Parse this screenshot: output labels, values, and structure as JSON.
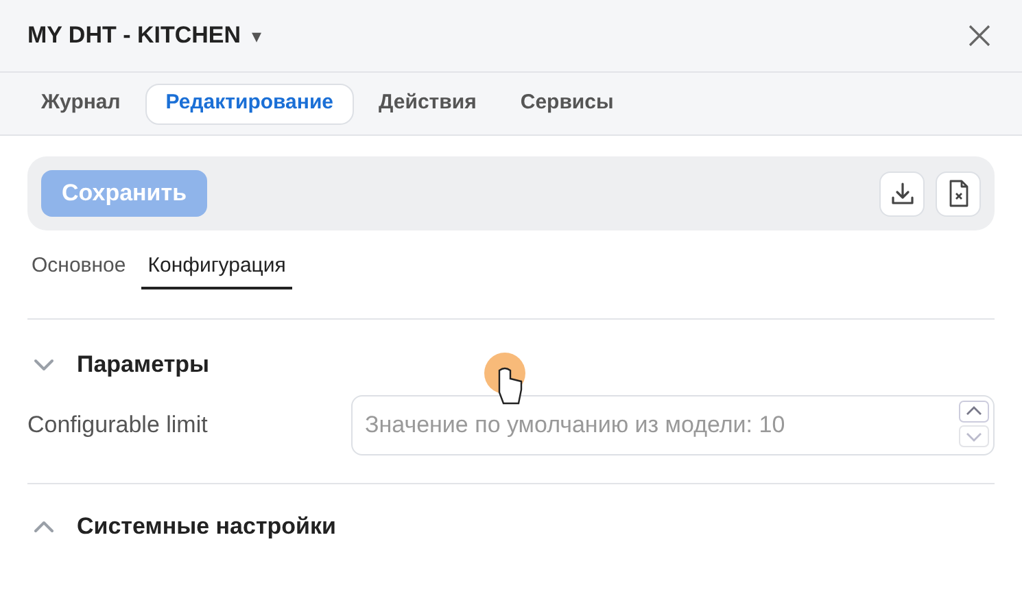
{
  "window": {
    "title": "MY DHT - KITCHEN",
    "title_dropdown": "▾"
  },
  "tabs": [
    {
      "label": "Журнал",
      "selected": false
    },
    {
      "label": "Редактирование",
      "selected": true
    },
    {
      "label": "Действия",
      "selected": false
    },
    {
      "label": "Сервисы",
      "selected": false
    }
  ],
  "toolbar": {
    "save_button": {
      "label": "Сохранить",
      "disabled": true
    }
  },
  "subtabs": [
    {
      "label": "Основное",
      "selected": false
    },
    {
      "label": "Конфигурация",
      "selected": true
    }
  ],
  "sections": [
    {
      "title": "Параметры",
      "expanded": true,
      "fields": [
        {
          "label": "Configurable limit",
          "placeholder": "Значение по умолчанию из модели: 10"
        }
      ]
    },
    {
      "title": "Системные настройки",
      "expanded": false
    }
  ]
}
